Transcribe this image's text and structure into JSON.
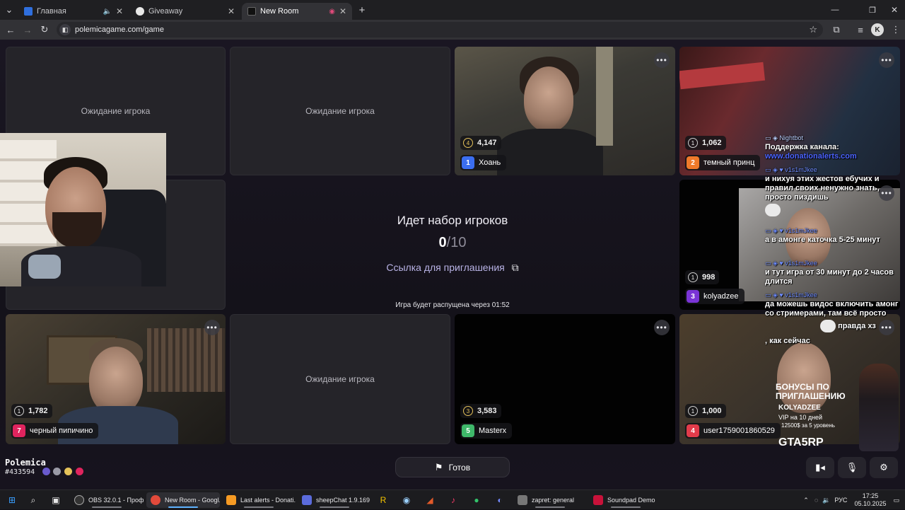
{
  "browser": {
    "tabs": [
      {
        "label": "Главная",
        "color": "#2f6fde"
      },
      {
        "label": "Giveaway",
        "color": "#e8e8e8"
      },
      {
        "label": "New Room",
        "color": "#111111"
      }
    ],
    "url": "polemicagame.com/game",
    "profile_initial": "K"
  },
  "game": {
    "waiting_text": "Ожидание игрока",
    "center": {
      "title": "Идет набор игроков",
      "count_current": "0",
      "count_total": "/10",
      "invite": "Ссылка для приглашения",
      "timer": "Игра будет распущена через 01:52"
    },
    "players": [
      {
        "num": "1",
        "name": "Хоань",
        "score": "4,147",
        "rank": "4",
        "color": "#3b6ef0"
      },
      {
        "num": "2",
        "name": "темный принц",
        "score": "1,062",
        "rank": "1",
        "color": "#ef7a2a"
      },
      {
        "num": "3",
        "name": "kolyadzee",
        "score": "998",
        "rank": "1",
        "color": "#7a34d6"
      },
      {
        "num": "7",
        "name": "черный пипичино",
        "score": "1,782",
        "rank": "1",
        "color": "#e0245e"
      },
      {
        "num": "5",
        "name": "Masterx",
        "score": "3,583",
        "rank": "3",
        "color": "#3fb86a"
      },
      {
        "num": "4",
        "name": "user1759001860529",
        "score": "1,000",
        "rank": "1",
        "color": "#e23b4a"
      }
    ],
    "more_label": "•••",
    "brand": "Polemica",
    "room_id": "#433594",
    "ready_label": "Готов"
  },
  "chat": {
    "messages": [
      {
        "user": "Nightbot",
        "text": "Поддержка канала: ",
        "link": "www.donationalerts.com"
      },
      {
        "user": "v1s1mJkee",
        "text": "и нихуя этих жестов ебучих и правил своих ненужно знать, просто пиздишь"
      },
      {
        "user": "v1s1mJkee",
        "text": "а в амонге каточка 5-25 минут"
      },
      {
        "user": "v1s1mJkee",
        "text": "и тут игра от 30 минут до 2 часов длится"
      },
      {
        "user": "v1s1mJkee",
        "text": "да можешь видос включить амонг со стримерами, там всё просто"
      },
      {
        "user": "",
        "text": "правда хз"
      },
      {
        "user": "",
        "text": ", как сейчас"
      }
    ]
  },
  "promo": {
    "line1": "БОНУСЫ ПО ПРИГЛАШЕНИЮ",
    "line2": "KOLYADZEE",
    "line3": "VIP на 10 дней",
    "line4": "12500$ за 5 уровень",
    "line5": "GTA5RP"
  },
  "taskbar": {
    "apps": [
      {
        "label": "OBS 32.0.1 - Проф...",
        "color": "#333"
      },
      {
        "label": "New Room - Googl...",
        "color": "#e24a3b"
      },
      {
        "label": "Last alerts - Donati...",
        "color": "#f59a23"
      },
      {
        "label": "sheepChat 1.9.169 ...",
        "color": "#5b6bdc"
      },
      {
        "label": "zapret: general",
        "color": "#777"
      },
      {
        "label": "Soundpad Demo",
        "color": "#c8123a"
      }
    ],
    "lang": "РУС",
    "time": "17:25",
    "date": "05.10.2025"
  }
}
